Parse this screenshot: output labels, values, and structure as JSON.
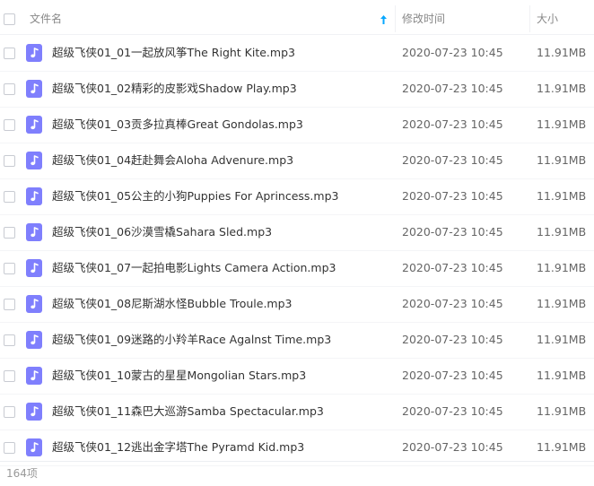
{
  "header": {
    "name_label": "文件名",
    "time_label": "修改时间",
    "size_label": "大小"
  },
  "accent_color": "#06a7ff",
  "file_icon_color": "#7f7ffd",
  "files": [
    {
      "name": "超级飞侠01_01一起放风筝The Right Kite.mp3",
      "time": "2020-07-23 10:45",
      "size": "11.91MB",
      "icon": "music-note-icon"
    },
    {
      "name": "超级飞侠01_02精彩的皮影戏Shadow Play.mp3",
      "time": "2020-07-23 10:45",
      "size": "11.91MB",
      "icon": "music-note-icon"
    },
    {
      "name": "超级飞侠01_03贡多拉真棒Great Gondolas.mp3",
      "time": "2020-07-23 10:45",
      "size": "11.91MB",
      "icon": "music-note-icon"
    },
    {
      "name": "超级飞侠01_04赶赴舞会Aloha Advenure.mp3",
      "time": "2020-07-23 10:45",
      "size": "11.91MB",
      "icon": "music-note-icon"
    },
    {
      "name": "超级飞侠01_05公主的小狗Puppies For Aprincess.mp3",
      "time": "2020-07-23 10:45",
      "size": "11.91MB",
      "icon": "music-note-icon"
    },
    {
      "name": "超级飞侠01_06沙漠雪橇Sahara Sled.mp3",
      "time": "2020-07-23 10:45",
      "size": "11.91MB",
      "icon": "music-note-icon"
    },
    {
      "name": "超级飞侠01_07一起拍电影Lights Camera Action.mp3",
      "time": "2020-07-23 10:45",
      "size": "11.91MB",
      "icon": "music-note-icon"
    },
    {
      "name": "超级飞侠01_08尼斯湖水怪Bubble Troule.mp3",
      "time": "2020-07-23 10:45",
      "size": "11.91MB",
      "icon": "music-note-icon"
    },
    {
      "name": "超级飞侠01_09迷路的小羚羊Race Agalnst Time.mp3",
      "time": "2020-07-23 10:45",
      "size": "11.91MB",
      "icon": "music-note-icon"
    },
    {
      "name": "超级飞侠01_10蒙古的星星Mongolian Stars.mp3",
      "time": "2020-07-23 10:45",
      "size": "11.91MB",
      "icon": "music-note-icon"
    },
    {
      "name": "超级飞侠01_11森巴大巡游Samba Spectacular.mp3",
      "time": "2020-07-23 10:45",
      "size": "11.91MB",
      "icon": "music-note-icon"
    },
    {
      "name": "超级飞侠01_12逃出金字塔The Pyramd Kid.mp3",
      "time": "2020-07-23 10:45",
      "size": "11.91MB",
      "icon": "music-note-icon"
    }
  ],
  "footer": {
    "count_text": "164项"
  }
}
